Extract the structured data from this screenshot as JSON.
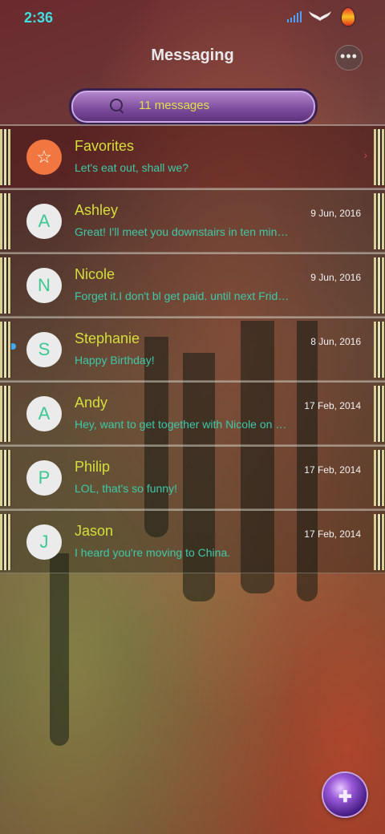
{
  "status_bar": {
    "time": "2:36"
  },
  "header": {
    "title": "Messaging",
    "more_label": "•••"
  },
  "search": {
    "placeholder": "11 messages"
  },
  "conversations": [
    {
      "initial": "☆",
      "name": "Favorites",
      "date": "",
      "preview": "Let's eat out, shall we?"
    },
    {
      "initial": "A",
      "name": "Ashley",
      "date": "9 Jun, 2016",
      "preview": "Great! I'll meet you downstairs in ten min…"
    },
    {
      "initial": "N",
      "name": "Nicole",
      "date": "9 Jun, 2016",
      "preview": "Forget it.I don't bl get paid. until next Frid…"
    },
    {
      "initial": "S",
      "name": "Stephanie",
      "date": "8 Jun, 2016",
      "preview": "Happy Birthday!"
    },
    {
      "initial": "A",
      "name": "Andy",
      "date": "17 Feb, 2014",
      "preview": "Hey, want to get together with Nicole on …"
    },
    {
      "initial": "P",
      "name": "Philip",
      "date": "17 Feb, 2014",
      "preview": "LOL, that's so funny!"
    },
    {
      "initial": "J",
      "name": "Jason",
      "date": "17 Feb, 2014",
      "preview": "I heard you're moving to China."
    }
  ],
  "fab": {
    "icon": "compose-icon",
    "glyph": "✚"
  },
  "colors": {
    "accent_name": "#d4df3a",
    "preview": "#3ec9a8",
    "unread": "#3ea8f0",
    "favorite": "#f27640"
  }
}
